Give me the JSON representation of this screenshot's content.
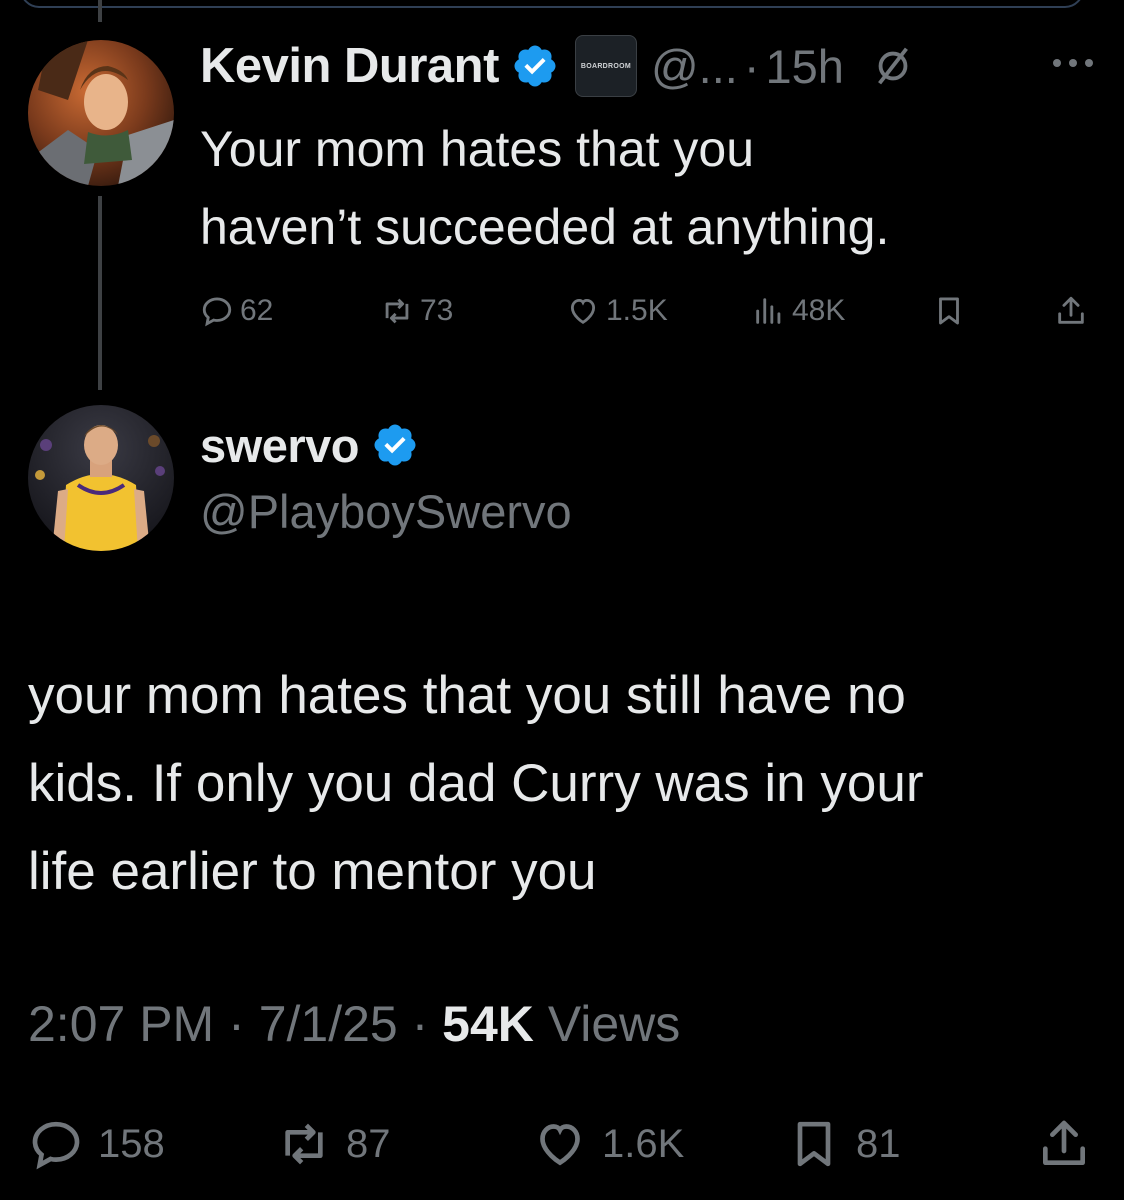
{
  "parent_tweet": {
    "display_name": "Kevin Durant",
    "org_badge_label": "BOARDROOM",
    "handle": "@...",
    "separator": "·",
    "time": "15h",
    "text_lines": [
      "Your mom hates that you",
      "haven’t succeeded at anything."
    ],
    "actions": {
      "replies": "62",
      "reposts": "73",
      "likes": "1.5K",
      "views": "48K"
    }
  },
  "reply_tweet": {
    "display_name": "swervo",
    "handle": "@PlayboySwervo",
    "text_lines": [
      "your mom hates that you still have no",
      "kids. If only you dad Curry was in your",
      "life earlier to mentor you"
    ],
    "meta": {
      "time": "2:07 PM",
      "sep1": "·",
      "date": "7/1/25",
      "sep2": "·",
      "views_count": "54K",
      "views_label": "Views"
    },
    "actions": {
      "replies": "158",
      "reposts": "87",
      "likes": "1.6K",
      "bookmarks": "81"
    }
  },
  "colors": {
    "background": "#000000",
    "text_primary": "#e7e9ea",
    "text_secondary": "#71767b",
    "verified_blue": "#1d9bf0",
    "thread_line": "#3e4144"
  },
  "icons": [
    "verified-icon",
    "grok-icon",
    "more-icon",
    "reply-icon",
    "repost-icon",
    "like-icon",
    "views-icon",
    "bookmark-icon",
    "share-icon"
  ]
}
